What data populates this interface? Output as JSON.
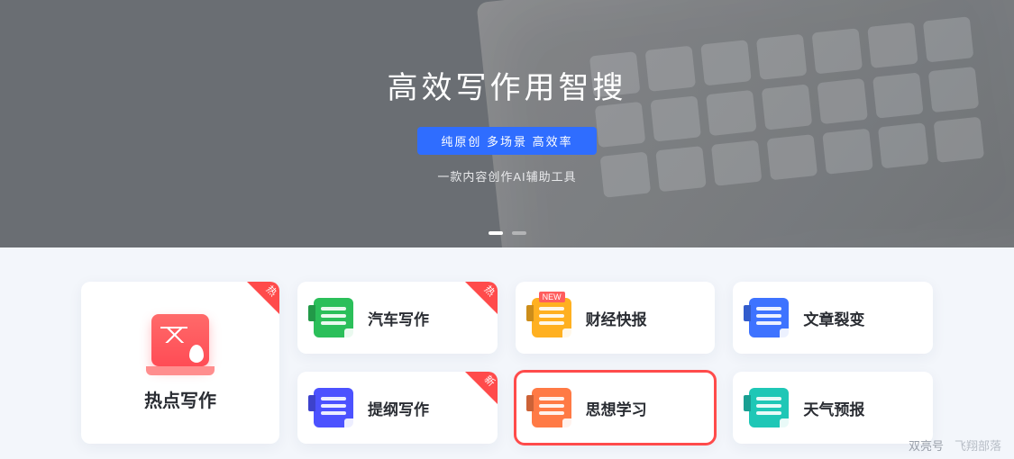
{
  "hero": {
    "title": "高效写作用智搜",
    "pill": "纯原创 多场景 高效率",
    "subtitle": "一款内容创作AI辅助工具"
  },
  "corners": {
    "hot": "热",
    "new": "新"
  },
  "tiles": {
    "big": {
      "label": "热点写作",
      "corner": "hot"
    },
    "row1": [
      {
        "label": "汽车写作",
        "icon": "green",
        "corner": "hot",
        "ribbon": null
      },
      {
        "label": "财经快报",
        "icon": "yellow",
        "corner": null,
        "ribbon": "NEW"
      },
      {
        "label": "文章裂变",
        "icon": "blue",
        "corner": null,
        "ribbon": null
      }
    ],
    "row2": [
      {
        "label": "提纲写作",
        "icon": "purple",
        "corner": "new",
        "ribbon": null
      },
      {
        "label": "思想学习",
        "icon": "orange",
        "corner": null,
        "ribbon": null,
        "selected": true
      },
      {
        "label": "天气预报",
        "icon": "teal",
        "corner": null,
        "ribbon": null
      }
    ]
  },
  "watermark": {
    "left": "双亮号",
    "right": "飞翔部落"
  }
}
